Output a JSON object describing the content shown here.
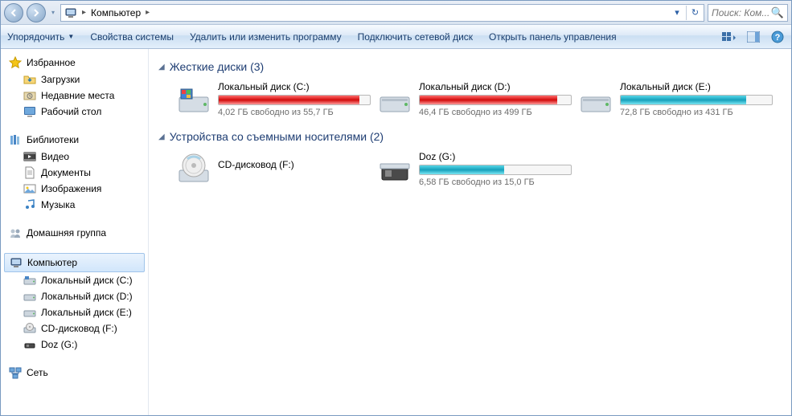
{
  "address": {
    "location": "Компьютер",
    "arrow": "▸"
  },
  "search": {
    "placeholder": "Поиск: Ком..."
  },
  "cmdbar": {
    "organize": "Упорядочить",
    "props": "Свойства системы",
    "uninstall": "Удалить или изменить программу",
    "mapdrive": "Подключить сетевой диск",
    "ctrlpanel": "Открыть панель управления"
  },
  "sidebar": {
    "favorites": {
      "label": "Избранное",
      "items": [
        "Загрузки",
        "Недавние места",
        "Рабочий стол"
      ]
    },
    "libraries": {
      "label": "Библиотеки",
      "items": [
        "Видео",
        "Документы",
        "Изображения",
        "Музыка"
      ]
    },
    "homegroup": {
      "label": "Домашняя группа"
    },
    "computer": {
      "label": "Компьютер",
      "items": [
        "Локальный диск (C:)",
        "Локальный диск (D:)",
        "Локальный диск (E:)",
        "CD-дисковод (F:)",
        "Doz (G:)"
      ]
    },
    "network": {
      "label": "Сеть"
    }
  },
  "groups": {
    "hdd": {
      "title": "Жесткие диски (3)"
    },
    "removable": {
      "title": "Устройства со съемными носителями (2)"
    }
  },
  "drives": {
    "c": {
      "name": "Локальный диск (C:)",
      "status": "4,02 ГБ свободно из 55,7 ГБ",
      "pct": 93,
      "color": "red"
    },
    "d": {
      "name": "Локальный диск (D:)",
      "status": "46,4 ГБ свободно из 499 ГБ",
      "pct": 91,
      "color": "red"
    },
    "e": {
      "name": "Локальный диск (E:)",
      "status": "72,8 ГБ свободно из 431 ГБ",
      "pct": 83,
      "color": "blue"
    },
    "f": {
      "name": "CD-дисковод (F:)"
    },
    "g": {
      "name": "Doz (G:)",
      "status": "6,58 ГБ свободно из 15,0 ГБ",
      "pct": 56,
      "color": "blue"
    }
  }
}
